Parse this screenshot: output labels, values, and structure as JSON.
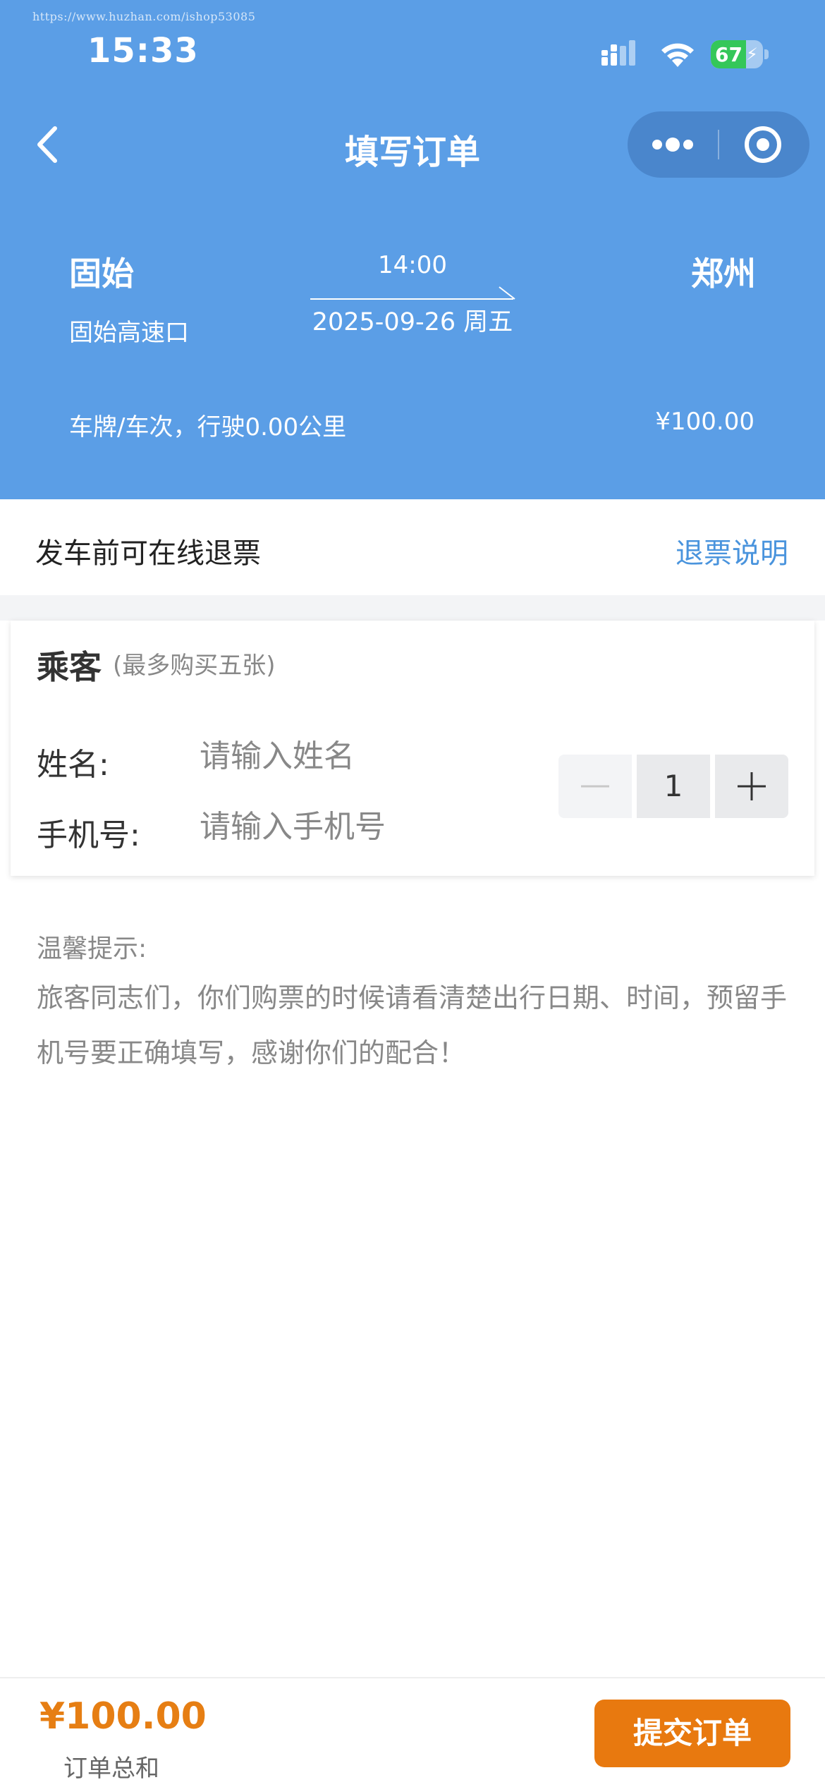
{
  "watermark": "https://www.huzhan.com/ishop53085",
  "status_bar": {
    "time": "15:33",
    "battery": "67",
    "battery_level": 0.67,
    "icons": [
      "signal-icon",
      "wifi-icon",
      "battery-icon"
    ]
  },
  "nav": {
    "title": "填写订单",
    "back_icon": "chevron-left-icon",
    "more_icon": "more-dots-icon",
    "close_icon": "target-close-icon"
  },
  "trip": {
    "origin_city": "固始",
    "origin_station": "固始高速口",
    "depart_time": "14:00",
    "depart_date": "2025-09-26 周五",
    "dest_city": "郑州",
    "info": "车牌/车次，行驶0.00公里",
    "price": "¥100.00"
  },
  "refund": {
    "text": "发车前可在线退票",
    "link": "退票说明"
  },
  "passenger": {
    "title": "乘客",
    "limit": "(最多购买五张)",
    "name_label": "姓名:",
    "name_placeholder": "请输入姓名",
    "phone_label": "手机号:",
    "phone_placeholder": "请输入手机号",
    "quantity": "1"
  },
  "tips": {
    "title": "温馨提示:",
    "body": "旅客同志们，你们购票的时候请看清楚出行日期、时间，预留手机号要正确填写，感谢你们的配合！"
  },
  "footer": {
    "total": "¥100.00",
    "total_label": "订单总和",
    "submit": "提交订单"
  },
  "colors": {
    "header_blue": "#5b9ee6",
    "link_blue": "#4a94dd",
    "accent_orange": "#e8790f",
    "battery_green": "#34c759"
  }
}
